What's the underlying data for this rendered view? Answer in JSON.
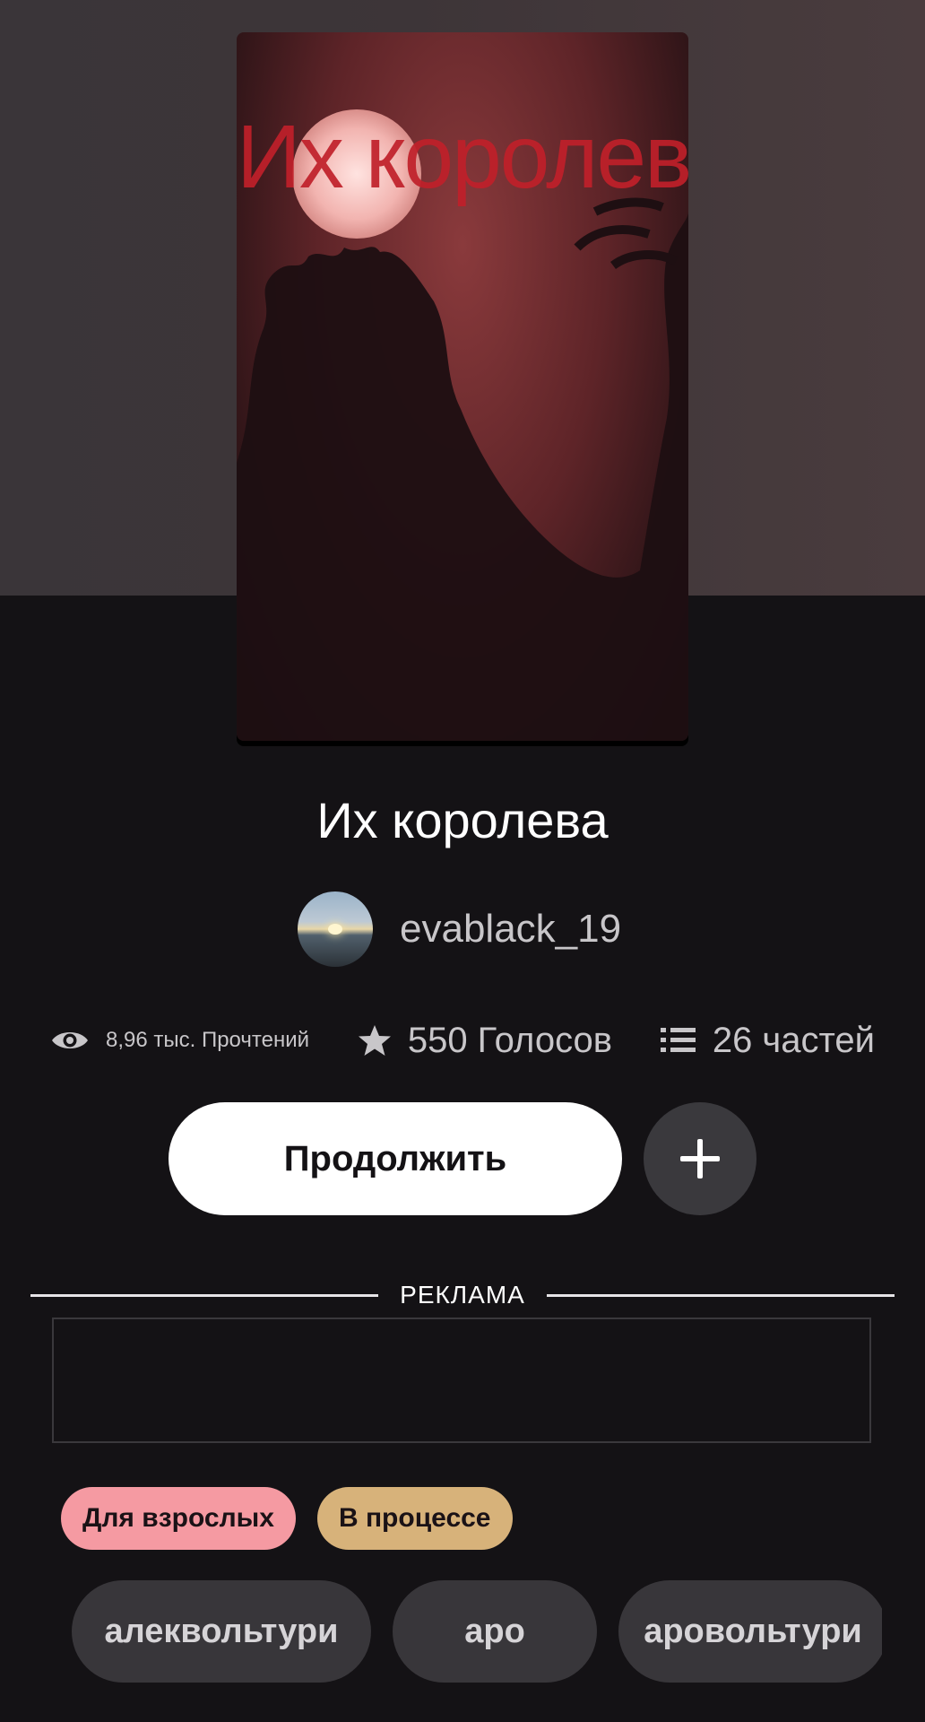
{
  "story": {
    "cover_title": "Их королева",
    "title": "Их королева",
    "author": "evablack_19"
  },
  "stats": {
    "reads": "8,96 тыс. Прочтений",
    "votes": "550 Голосов",
    "parts": "26 частей"
  },
  "actions": {
    "continue_label": "Продолжить",
    "add_icon": "plus-icon"
  },
  "ad": {
    "label": "РЕКЛАМА"
  },
  "badges": [
    {
      "label": "Для взрослых",
      "color": "#f59aa2"
    },
    {
      "label": "В процессе",
      "color": "#d7b27a"
    }
  ],
  "tags": [
    "алеквольтури",
    "аро",
    "аровольтури"
  ],
  "colors": {
    "background": "#141215",
    "button_primary": "#ffffff",
    "button_secondary": "#3a393d"
  }
}
